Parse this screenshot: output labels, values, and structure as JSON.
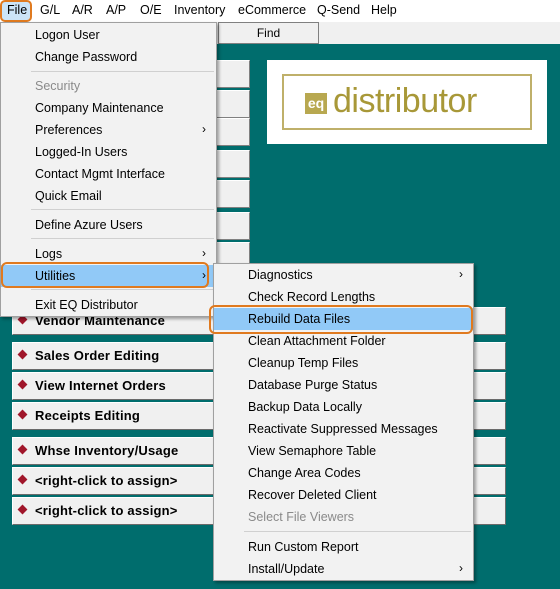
{
  "menubar": [
    "File",
    "G/L",
    "A/R",
    "A/P",
    "O/E",
    "Inventory",
    "eCommerce",
    "Q-Send",
    "Help"
  ],
  "toolbar": {
    "find_label": "Find"
  },
  "buttons": [
    "Vendor Maintenance",
    "Sales Order Editing",
    "View Internet Orders",
    "Receipts Editing",
    "Whse Inventory/Usage",
    "<right-click to assign>",
    "<right-click to assign>"
  ],
  "logo": {
    "mark": "eq",
    "text": "distributor"
  },
  "file_menu": {
    "group1": [
      "Logon User",
      "Change Password"
    ],
    "group2": [
      "Security",
      "Company Maintenance",
      "Preferences",
      "Logged-In Users",
      "Contact Mgmt Interface",
      "Quick Email"
    ],
    "group3": [
      "Define Azure Users"
    ],
    "group4": [
      "Logs",
      "Utilities"
    ],
    "group5": [
      "Exit EQ Distributor"
    ]
  },
  "utilities_menu": {
    "group1": [
      "Diagnostics",
      "Check Record Lengths",
      "Rebuild Data Files",
      "Clean Attachment Folder",
      "Cleanup Temp Files",
      "Database Purge Status",
      "Backup Data Locally",
      "Reactivate Suppressed Messages",
      "View Semaphore Table",
      "Change Area Codes",
      "Recover Deleted Client",
      "Select File Viewers"
    ],
    "group2": [
      "Run Custom Report",
      "Install/Update"
    ]
  },
  "colors": {
    "background": "#006d6d",
    "highlight": "#91c9f7",
    "callout": "#e07a1f",
    "diamond": "#a0162a",
    "logo": "#b8a850"
  }
}
